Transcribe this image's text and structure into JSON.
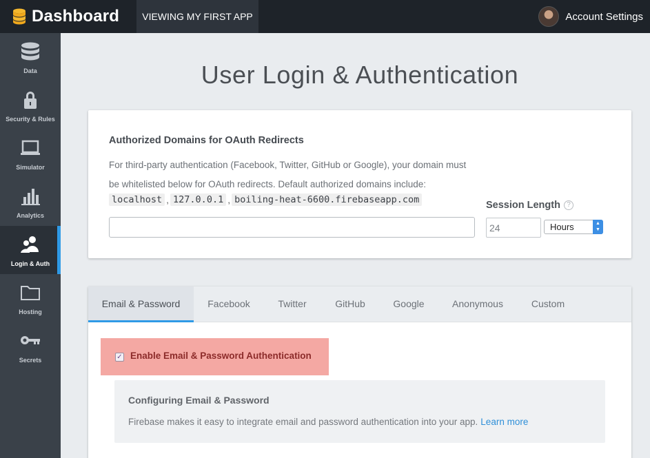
{
  "topbar": {
    "brand_title": "Dashboard",
    "app_tab": "VIEWING MY FIRST APP",
    "account_label": "Account Settings"
  },
  "sidebar": {
    "items": [
      {
        "label": "Data",
        "icon": "database-icon"
      },
      {
        "label": "Security & Rules",
        "icon": "lock-icon"
      },
      {
        "label": "Simulator",
        "icon": "laptop-icon"
      },
      {
        "label": "Analytics",
        "icon": "bar-chart-icon"
      },
      {
        "label": "Login & Auth",
        "icon": "users-icon",
        "active": true
      },
      {
        "label": "Hosting",
        "icon": "folder-icon"
      },
      {
        "label": "Secrets",
        "icon": "key-icon"
      }
    ]
  },
  "main": {
    "title": "User Login & Authentication",
    "domains": {
      "heading": "Authorized Domains for OAuth Redirects",
      "description": "For third-party authentication (Facebook, Twitter, GitHub or Google), your domain must be whitelisted below for OAuth redirects. Default authorized domains include:",
      "defaults": [
        "localhost",
        "127.0.0.1",
        "boiling-heat-6600.firebaseapp.com"
      ],
      "input_value": ""
    },
    "session": {
      "label": "Session Length",
      "help_icon": "?",
      "value": "24",
      "unit": "Hours"
    },
    "providers": {
      "tabs": [
        "Email & Password",
        "Facebook",
        "Twitter",
        "GitHub",
        "Google",
        "Anonymous",
        "Custom"
      ],
      "active_tab": "Email & Password",
      "enable_label": "Enable Email & Password Authentication",
      "enable_checked": true,
      "info_title": "Configuring Email & Password",
      "info_text": "Firebase makes it easy to integrate email and password authentication into your app.",
      "learn_more": "Learn more"
    }
  },
  "colors": {
    "accent": "#2f9ae6",
    "topbar": "#1e2329",
    "sidebar": "#3a4149",
    "highlight": "#f4a8a3"
  }
}
